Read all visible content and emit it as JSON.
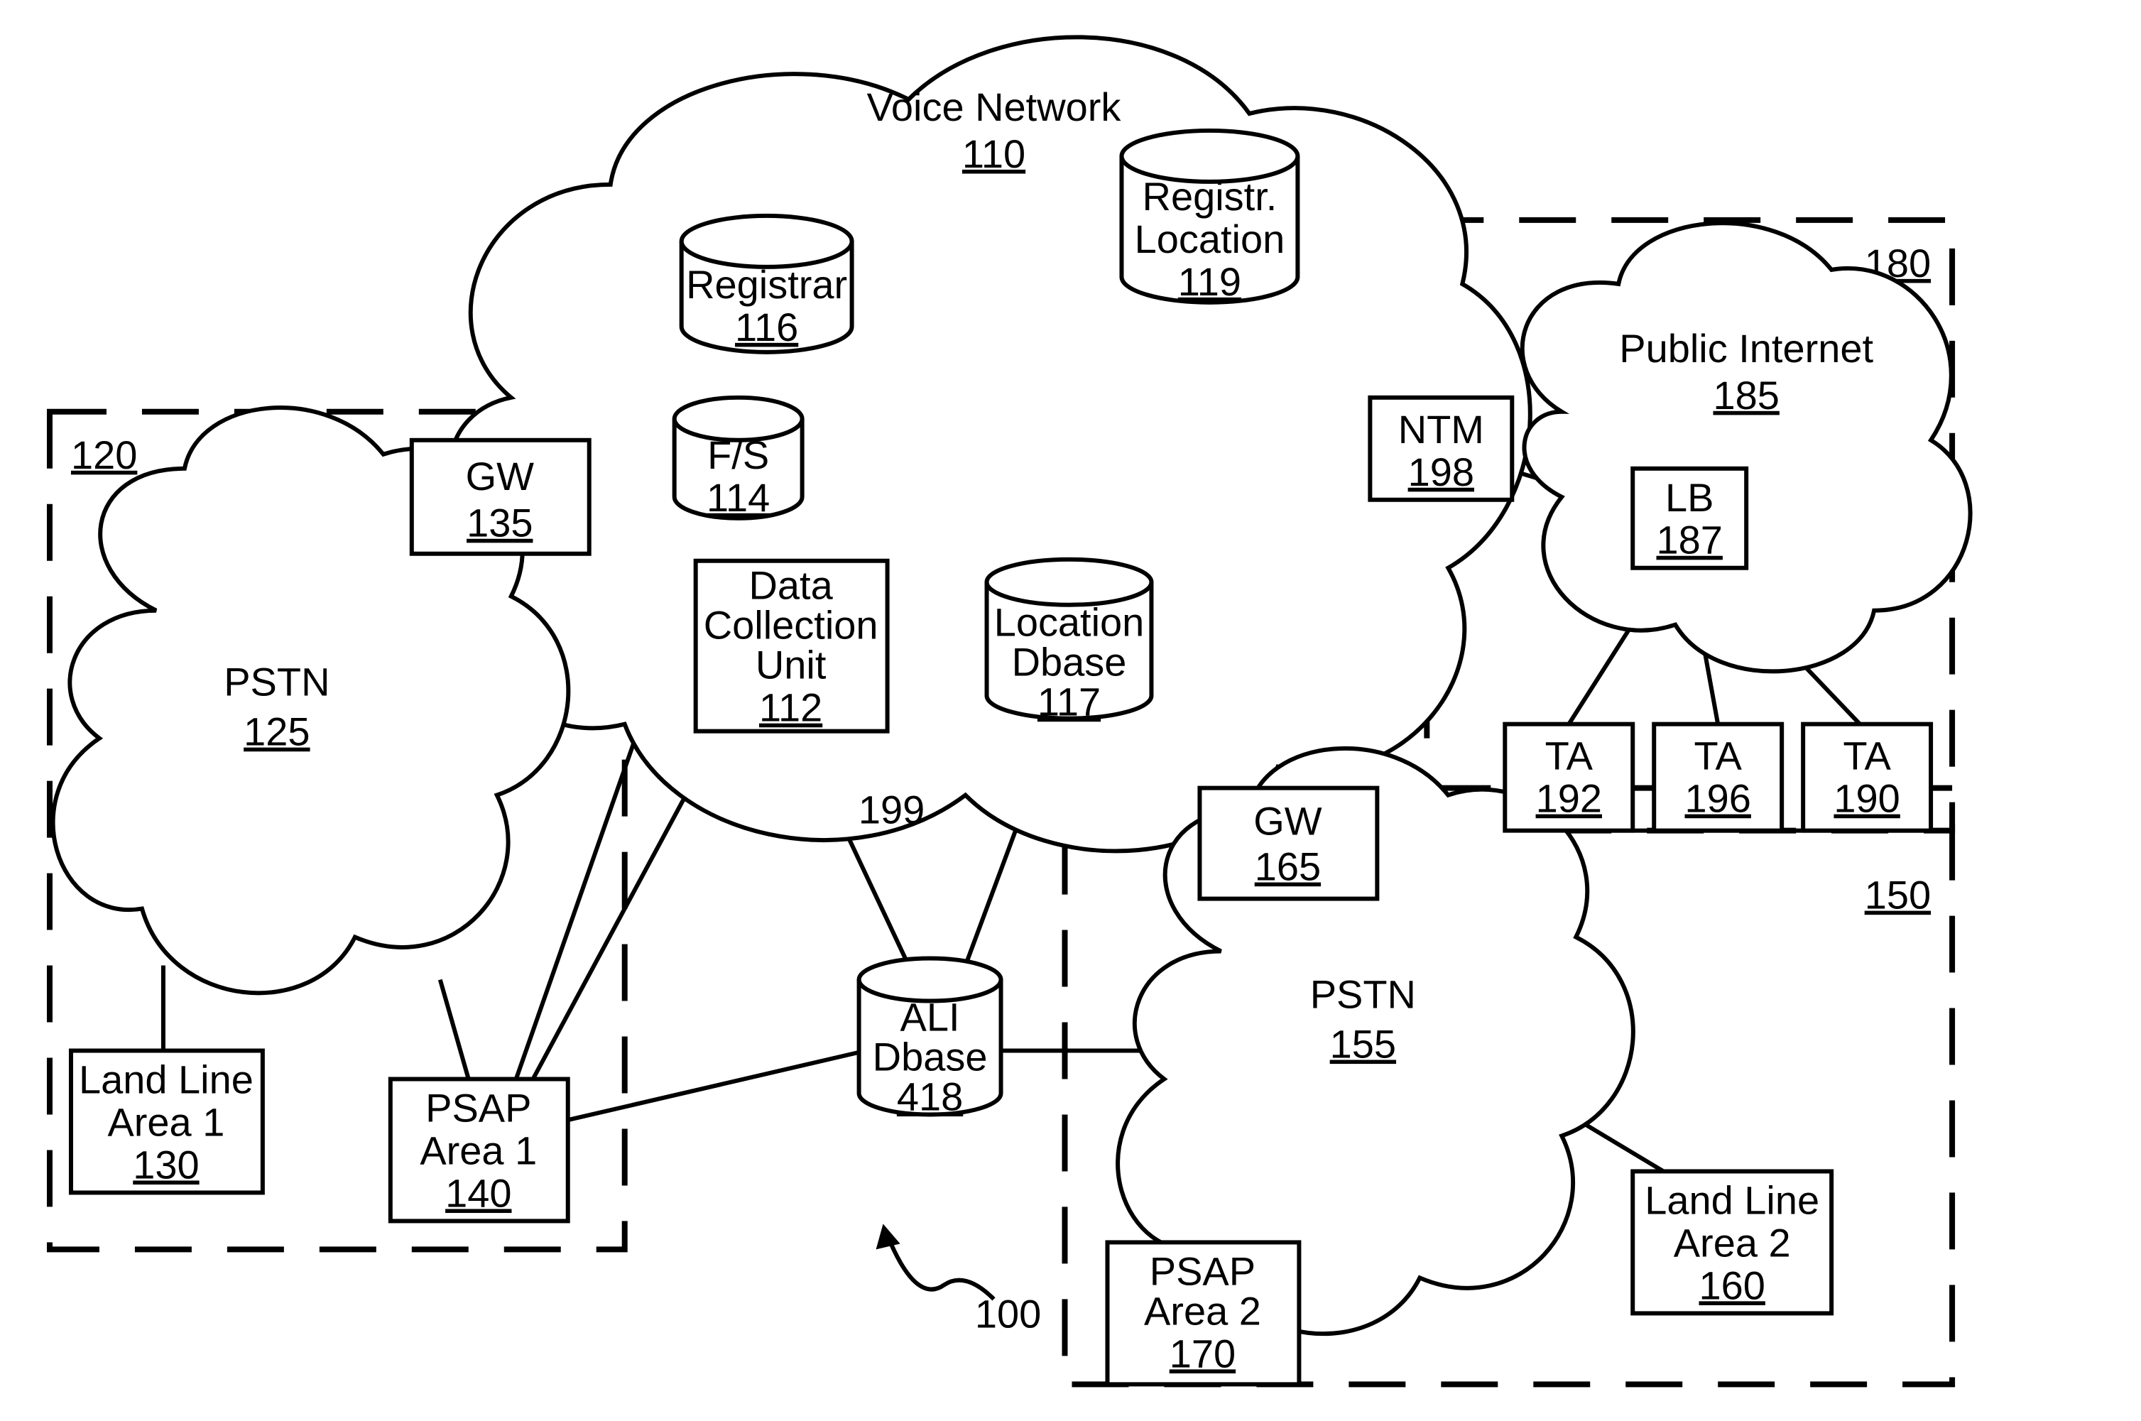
{
  "diagram": {
    "figure_ref": "100",
    "center_group_ref": "199",
    "groups": {
      "g120": {
        "ref": "120"
      },
      "g150": {
        "ref": "150"
      },
      "g180": {
        "ref": "180"
      }
    },
    "clouds": {
      "voice_network": {
        "label": "Voice Network",
        "ref": "110"
      },
      "pstn_left": {
        "label": "PSTN",
        "ref": "125"
      },
      "pstn_right": {
        "label": "PSTN",
        "ref": "155"
      },
      "public_internet": {
        "label": "Public Internet",
        "ref": "185"
      }
    },
    "boxes": {
      "gw_left": {
        "label": "GW",
        "ref": "135"
      },
      "gw_right": {
        "label": "GW",
        "ref": "165"
      },
      "ntm": {
        "label": "NTM",
        "ref": "198"
      },
      "lb": {
        "label": "LB",
        "ref": "187"
      },
      "ta_a": {
        "label": "TA",
        "ref": "192"
      },
      "ta_b": {
        "label": "TA",
        "ref": "196"
      },
      "ta_c": {
        "label": "TA",
        "ref": "190"
      },
      "landline1": {
        "line1": "Land Line",
        "line2": "Area 1",
        "ref": "130"
      },
      "psap1": {
        "line1": "PSAP",
        "line2": "Area 1",
        "ref": "140"
      },
      "landline2": {
        "line1": "Land Line",
        "line2": "Area 2",
        "ref": "160"
      },
      "psap2": {
        "line1": "PSAP",
        "line2": "Area 2",
        "ref": "170"
      },
      "dcu": {
        "line1": "Data",
        "line2": "Collection",
        "line3": "Unit",
        "ref": "112"
      }
    },
    "cylinders": {
      "registrar": {
        "label": "Registrar",
        "ref": "116"
      },
      "reg_loc": {
        "line1": "Registr.",
        "line2": "Location",
        "ref": "119"
      },
      "fs": {
        "label": "F/S",
        "ref": "114"
      },
      "loc_dbase": {
        "line1": "Location",
        "line2": "Dbase",
        "ref": "117"
      },
      "ali_dbase": {
        "line1": "ALI",
        "line2": "Dbase",
        "ref": "418"
      }
    }
  }
}
